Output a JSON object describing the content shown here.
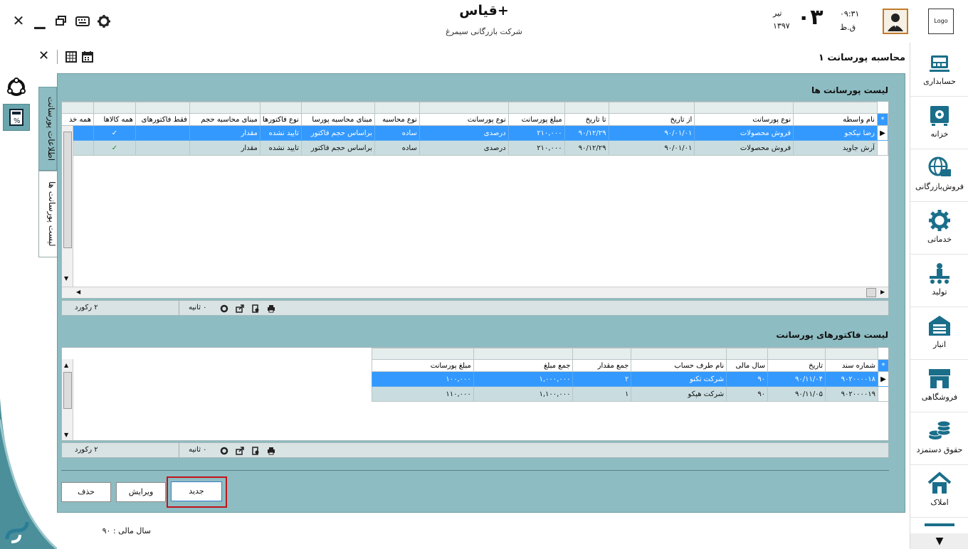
{
  "app": {
    "title": "قیاس+",
    "company": "شرکت بازرگانی سیمرغ"
  },
  "header": {
    "time": "۰۹:۳۱",
    "ampm": "ق.ظ",
    "day": "۰۳",
    "month": "تیر",
    "year": "۱۳۹۷",
    "logo": "Logo"
  },
  "page_title": "محاسبه پورسانت ۱",
  "vtabs": {
    "info": "اطلاعات پورسانت",
    "list": "لیست پورسانت ها"
  },
  "sidebar": {
    "items": [
      {
        "label": "حسابداری",
        "icon": "accounting-icon"
      },
      {
        "label": "خزانه",
        "icon": "safe-icon"
      },
      {
        "label": "فروش‌بازرگانی",
        "icon": "globe-trade-icon"
      },
      {
        "label": "خدماتی",
        "icon": "gear-icon"
      },
      {
        "label": "تولید",
        "icon": "production-icon"
      },
      {
        "label": "انبار",
        "icon": "warehouse-icon"
      },
      {
        "label": "فروشگاهی",
        "icon": "store-icon"
      },
      {
        "label": "حقوق دستمزد",
        "icon": "coins-icon"
      },
      {
        "label": "املاک",
        "icon": "house-icon"
      }
    ]
  },
  "commissions": {
    "title": "لیست پورسانت ها",
    "columns": [
      "نام واسطه",
      "نوع پورسانت",
      "از تاریخ",
      "تا تاریخ",
      "مبلغ پورسانت",
      "نوع پورسانت",
      "نوع محاسبه",
      "مبنای محاسبه پورسا",
      "نوع فاکتورها",
      "مبنای محاسبه حجم",
      "فقط فاکتورهای",
      "همه کالاها",
      "همه خد"
    ],
    "rows": [
      [
        "رضا نیکجو",
        "فروش محصولات",
        "۹۰/۰۱/۰۱",
        "۹۰/۱۲/۲۹",
        "۲۱۰,۰۰۰",
        "درصدی",
        "ساده",
        "براساس حجم فاکتور",
        "تایید نشده",
        "مقدار",
        "",
        "✓",
        ""
      ],
      [
        "آرش جاوید",
        "فروش محصولات",
        "۹۰/۰۱/۰۱",
        "۹۰/۱۲/۲۹",
        "۲۱۰,۰۰۰",
        "درصدی",
        "ساده",
        "براساس حجم فاکتور",
        "تایید نشده",
        "مقدار",
        "",
        "✓",
        ""
      ]
    ],
    "records": "۲ رکورد",
    "time": "۰ ثانیه"
  },
  "invoices": {
    "title": "لیست فاکتورهای پورسانت",
    "columns": [
      "شماره سند",
      "تاریخ",
      "سال مالی",
      "نام طرف حساب",
      "جمع مقدار",
      "جمع مبلغ",
      "مبلغ پورسانت"
    ],
    "rows": [
      [
        "۹۰۲۰۰۰۰۱۸",
        "۹۰/۱۱/۰۴",
        "۹۰",
        "شرکت تکنو",
        "۲",
        "۱,۰۰۰,۰۰۰",
        "۱۰۰,۰۰۰"
      ],
      [
        "۹۰۲۰۰۰۰۱۹",
        "۹۰/۱۱/۰۵",
        "۹۰",
        "شرکت هپکو",
        "۱",
        "۱,۱۰۰,۰۰۰",
        "۱۱۰,۰۰۰"
      ]
    ],
    "records": "۲ رکورد",
    "time": "۰ ثانیه"
  },
  "buttons": {
    "new": "جدید",
    "edit": "ویرایش",
    "delete": "حذف"
  },
  "status": {
    "fiscal_year": "سال مالی : ۹۰"
  },
  "colors": {
    "panel": "#8dbcc2",
    "selected": "#3399ff",
    "highlight": "#c0141b",
    "brand": "#1a6e8a"
  }
}
